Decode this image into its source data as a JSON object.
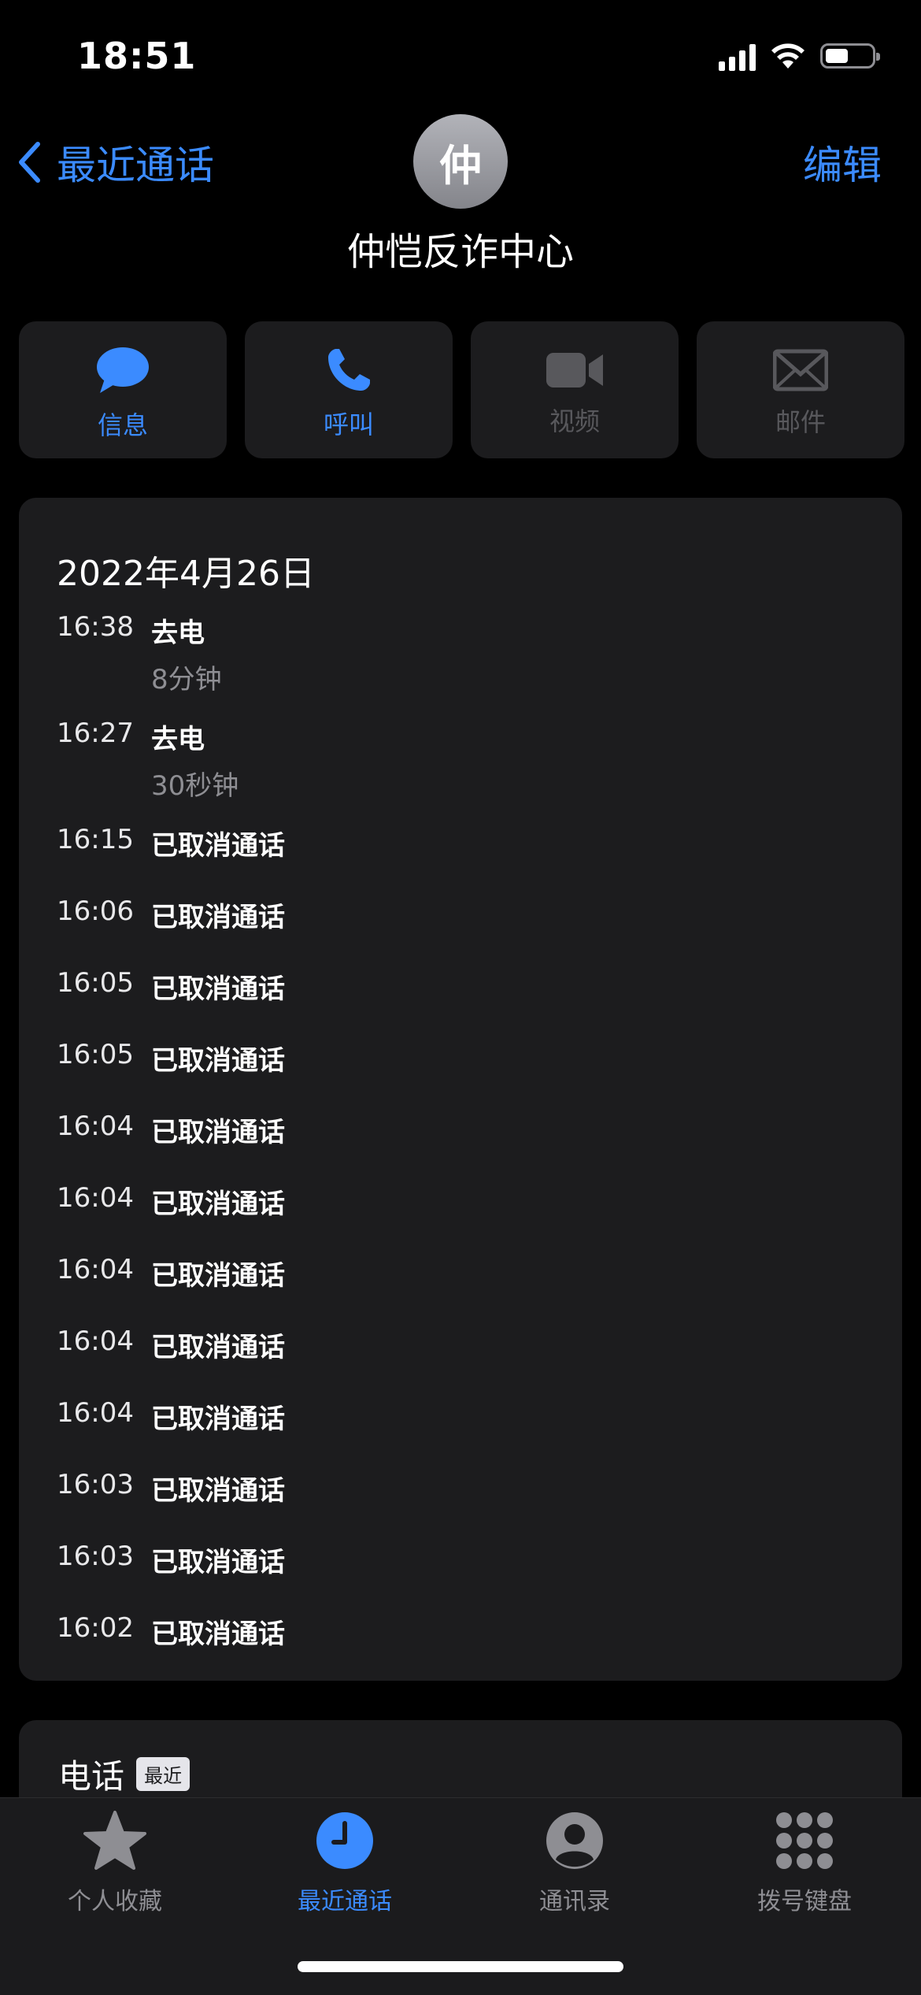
{
  "status_bar": {
    "time": "18:51"
  },
  "nav": {
    "back_label": "最近通话",
    "edit_label": "编辑"
  },
  "contact": {
    "avatar_letter": "仲",
    "name": "仲恺反诈中心"
  },
  "actions": [
    {
      "label": "信息",
      "icon": "message-icon",
      "enabled": true
    },
    {
      "label": "呼叫",
      "icon": "phone-icon",
      "enabled": true
    },
    {
      "label": "视频",
      "icon": "video-icon",
      "enabled": false
    },
    {
      "label": "邮件",
      "icon": "mail-icon",
      "enabled": false
    }
  ],
  "history": {
    "date": "2022年4月26日",
    "calls": [
      {
        "time": "16:38",
        "type": "去电",
        "duration": "8分钟"
      },
      {
        "time": "16:27",
        "type": "去电",
        "duration": "30秒钟"
      },
      {
        "time": "16:15",
        "type": "已取消通话"
      },
      {
        "time": "16:06",
        "type": "已取消通话"
      },
      {
        "time": "16:05",
        "type": "已取消通话"
      },
      {
        "time": "16:05",
        "type": "已取消通话"
      },
      {
        "time": "16:04",
        "type": "已取消通话"
      },
      {
        "time": "16:04",
        "type": "已取消通话"
      },
      {
        "time": "16:04",
        "type": "已取消通话"
      },
      {
        "time": "16:04",
        "type": "已取消通话"
      },
      {
        "time": "16:04",
        "type": "已取消通话"
      },
      {
        "time": "16:03",
        "type": "已取消通话"
      },
      {
        "time": "16:03",
        "type": "已取消通话"
      },
      {
        "time": "16:02",
        "type": "已取消通话"
      }
    ]
  },
  "phone_section": {
    "title": "电话",
    "badge": "最近"
  },
  "tab_bar": {
    "tabs": [
      {
        "label": "个人收藏",
        "icon": "star-icon"
      },
      {
        "label": "最近通话",
        "icon": "clock-icon"
      },
      {
        "label": "通讯录",
        "icon": "person-icon"
      },
      {
        "label": "拨号键盘",
        "icon": "keypad-icon"
      }
    ],
    "active_index": 1
  },
  "colors": {
    "accent": "#3b8bff",
    "card": "#1c1c1e",
    "secondary_text": "#8e8e93"
  }
}
